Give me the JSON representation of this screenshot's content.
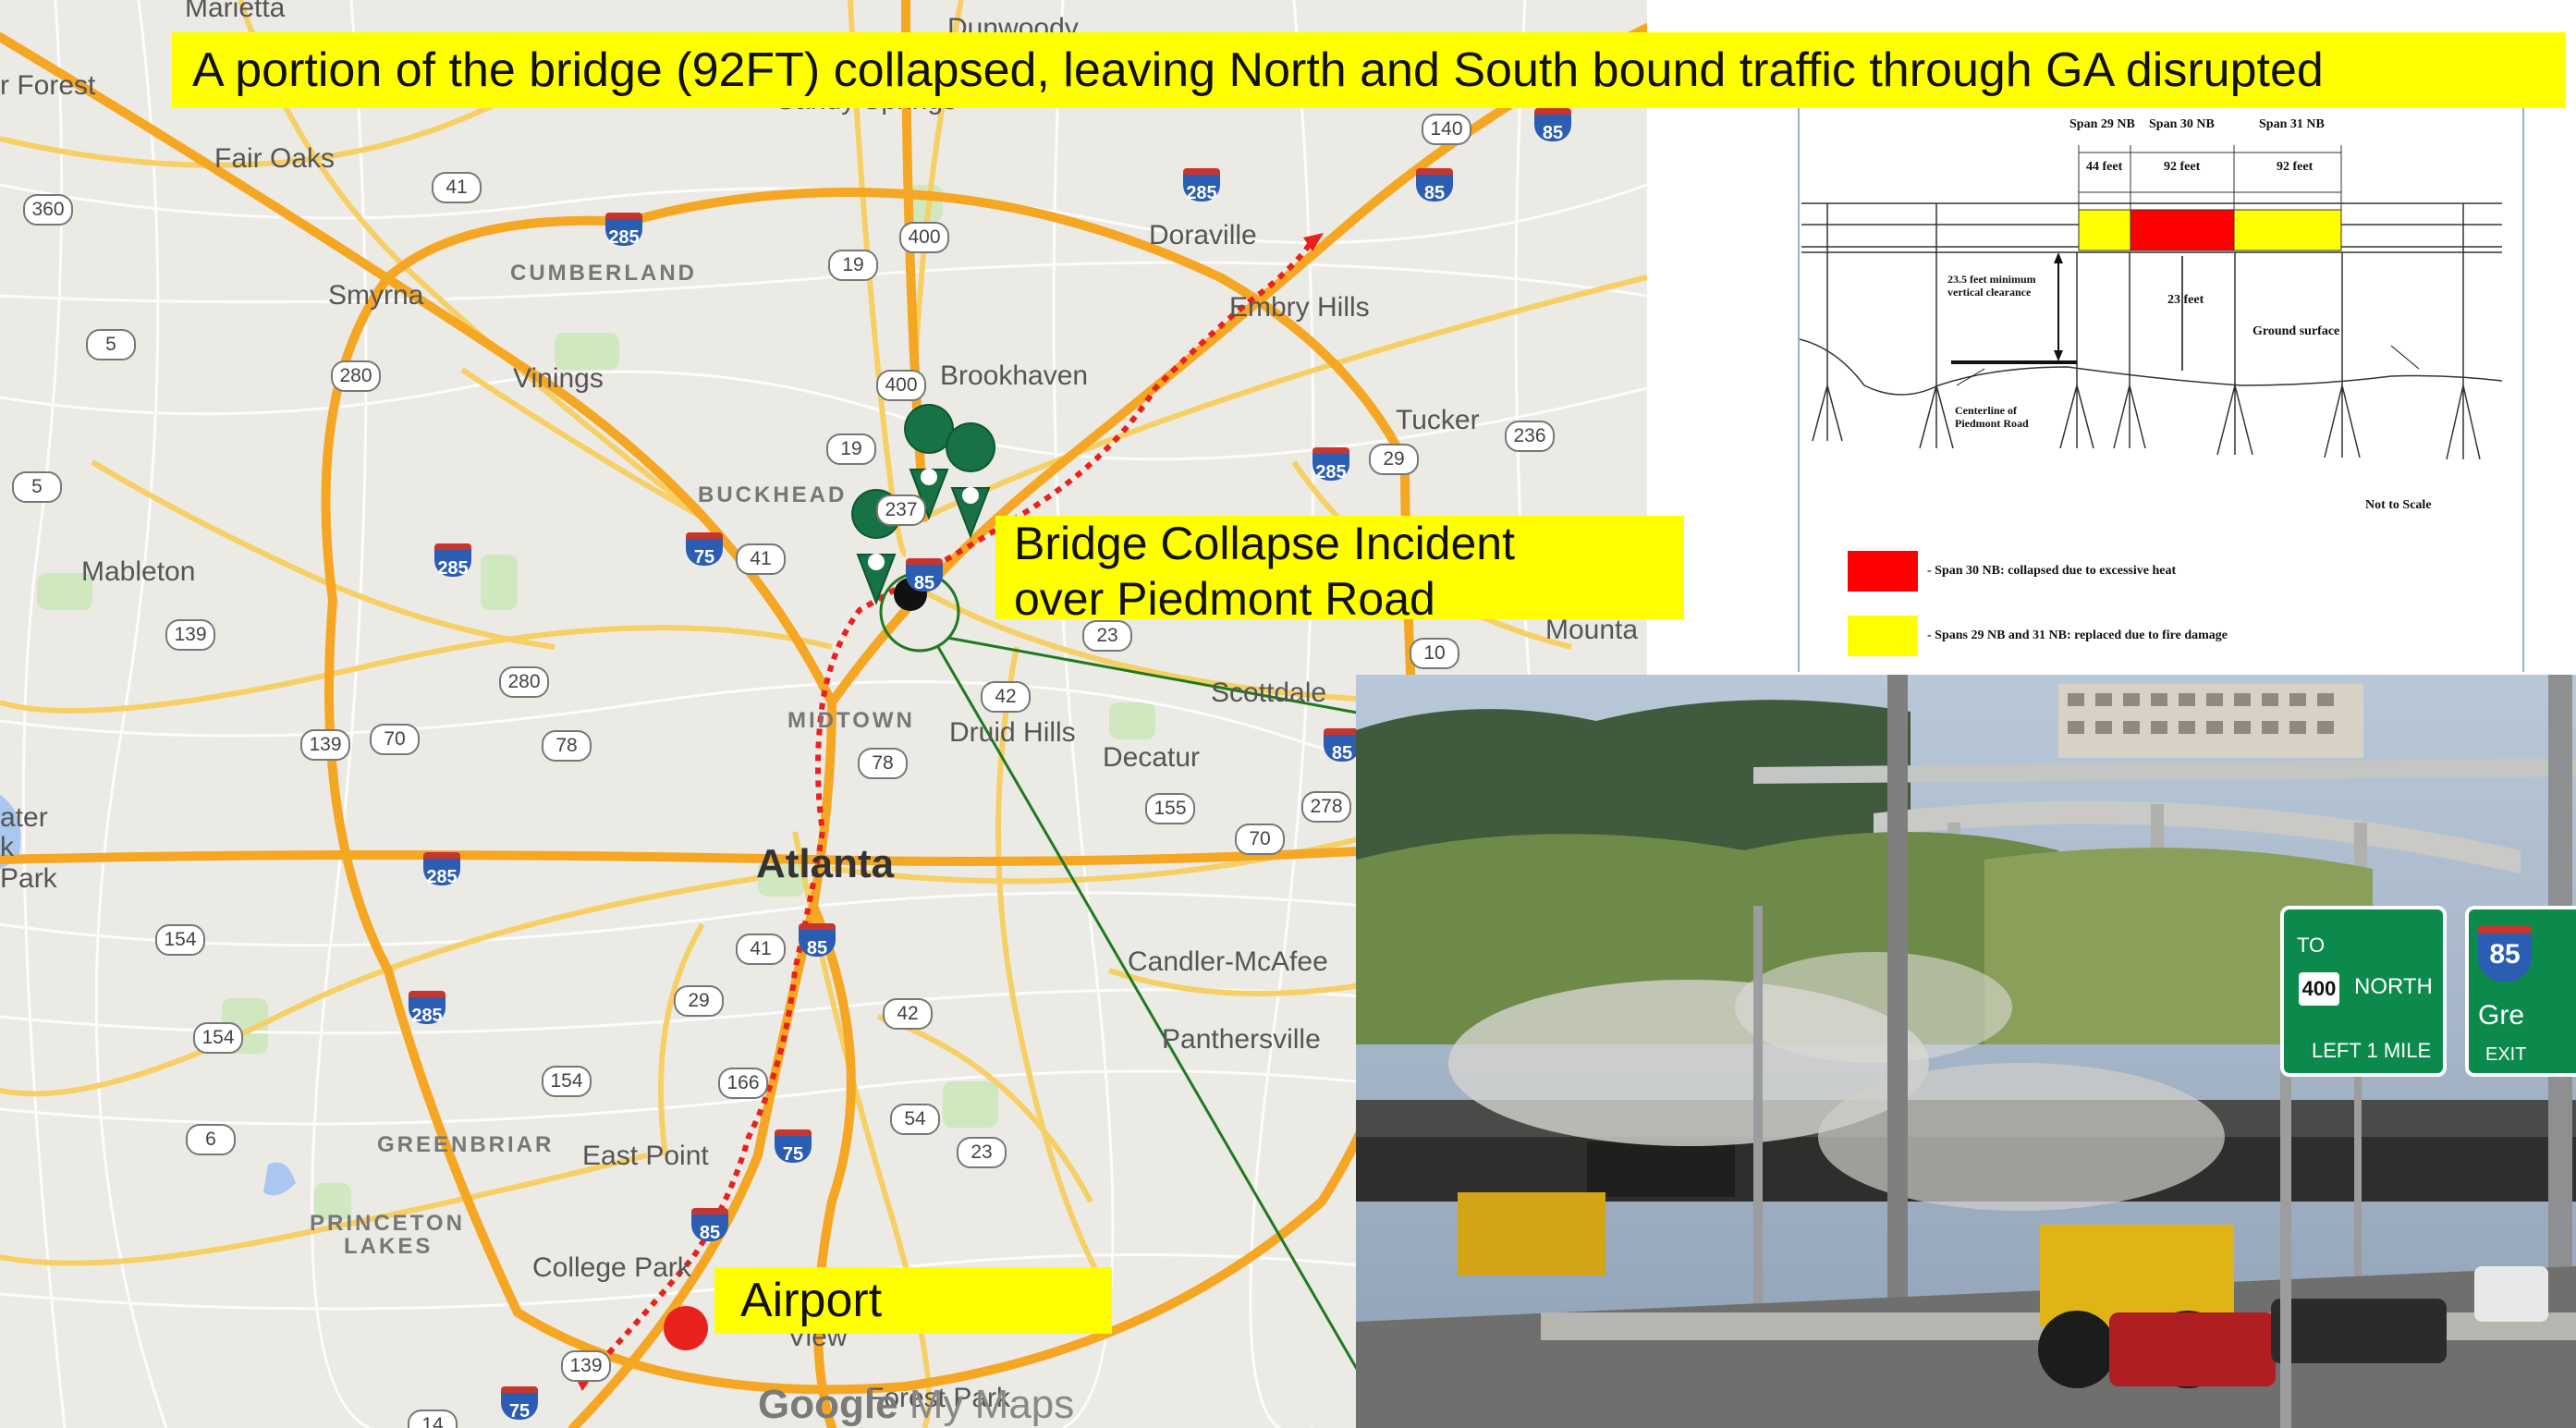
{
  "banner": {
    "title": "A portion of the bridge (92FT) collapsed, leaving North and South bound traffic through GA disrupted"
  },
  "map": {
    "places": [
      {
        "name": "Marietta",
        "style": "normal"
      },
      {
        "name": "r Forest",
        "style": "normal"
      },
      {
        "name": "Fair Oaks",
        "style": "normal"
      },
      {
        "name": "Smyrna",
        "style": "normal"
      },
      {
        "name": "CUMBERLAND",
        "style": "caps"
      },
      {
        "name": "Vinings",
        "style": "normal"
      },
      {
        "name": "Mableton",
        "style": "normal"
      },
      {
        "name": "BUCKHEAD",
        "style": "caps"
      },
      {
        "name": "Brookhaven",
        "style": "normal"
      },
      {
        "name": "Doraville",
        "style": "normal"
      },
      {
        "name": "Embry Hills",
        "style": "normal"
      },
      {
        "name": "Tucker",
        "style": "normal"
      },
      {
        "name": "Mounta",
        "style": "normal"
      },
      {
        "name": "Scottdale",
        "style": "normal"
      },
      {
        "name": "Druid Hills",
        "style": "normal"
      },
      {
        "name": "Decatur",
        "style": "normal"
      },
      {
        "name": "MIDTOWN",
        "style": "caps"
      },
      {
        "name": "Atlanta",
        "style": "big"
      },
      {
        "name": "Candler-McAfee",
        "style": "normal"
      },
      {
        "name": "Panthersville",
        "style": "normal"
      },
      {
        "name": "East Point",
        "style": "normal"
      },
      {
        "name": "GREENBRIAR",
        "style": "caps"
      },
      {
        "name": "PRINCETON",
        "style": "caps"
      },
      {
        "name": "LAKES",
        "style": "caps"
      },
      {
        "name": "College Park",
        "style": "normal"
      },
      {
        "name": "ater",
        "style": "normal"
      },
      {
        "name": "k",
        "style": "normal"
      },
      {
        "name": "Park",
        "style": "normal"
      },
      {
        "name": "Dunwoody",
        "style": "normal"
      },
      {
        "name": "Sandy Springs",
        "style": "normal"
      },
      {
        "name": "View",
        "style": "normal"
      },
      {
        "name": "Forest Park",
        "style": "normal"
      }
    ],
    "state_routes": [
      "360",
      "41",
      "19",
      "400",
      "140",
      "5",
      "280",
      "400",
      "19",
      "236",
      "29",
      "5",
      "237",
      "139",
      "41",
      "23",
      "10",
      "280",
      "42",
      "139",
      "70",
      "78",
      "78",
      "155",
      "278",
      "154",
      "70",
      "41",
      "29",
      "42",
      "154",
      "154",
      "166",
      "54",
      "6",
      "23",
      "139",
      "14"
    ],
    "interstates": [
      "85",
      "285",
      "85",
      "285",
      "75",
      "285",
      "85",
      "285",
      "85",
      "285",
      "85",
      "75",
      "85",
      "285"
    ],
    "watermark": {
      "brand": "Google",
      "product": "My Maps"
    },
    "colors": {
      "route": "#e8211d",
      "pin": "#177245",
      "callout_line": "#1f7a1f"
    }
  },
  "incident": {
    "line1": "Bridge Collapse Incident",
    "line2": "over Piedmont Road"
  },
  "airport": {
    "label": "Airport"
  },
  "diagram": {
    "span_labels": [
      "Span 29 NB",
      "Span 30 NB",
      "Span 31 NB"
    ],
    "span_lengths": [
      "44 feet",
      "92 feet",
      "92 feet"
    ],
    "clearance_note": "23.5 feet minimum vertical clearance",
    "height_label": "23 feet",
    "ground_label": "Ground surface",
    "centerline_note": "Centerline of Piedmont Road",
    "scale_note": "Not to Scale",
    "legend": [
      {
        "color": "#ff0000",
        "text": "- Span 30 NB: collapsed due to excessive heat"
      },
      {
        "color": "#ffff00",
        "text": "- Spans 29 NB and 31 NB: replaced due to fire damage"
      }
    ]
  },
  "photo": {
    "sign_to": "TO",
    "sign_route": "400",
    "sign_dir": "NORTH",
    "sign_exit": "LEFT 1 MILE",
    "sign_interstate": "85",
    "sign_exit2": "EXIT",
    "sign_partial": "Gre"
  }
}
